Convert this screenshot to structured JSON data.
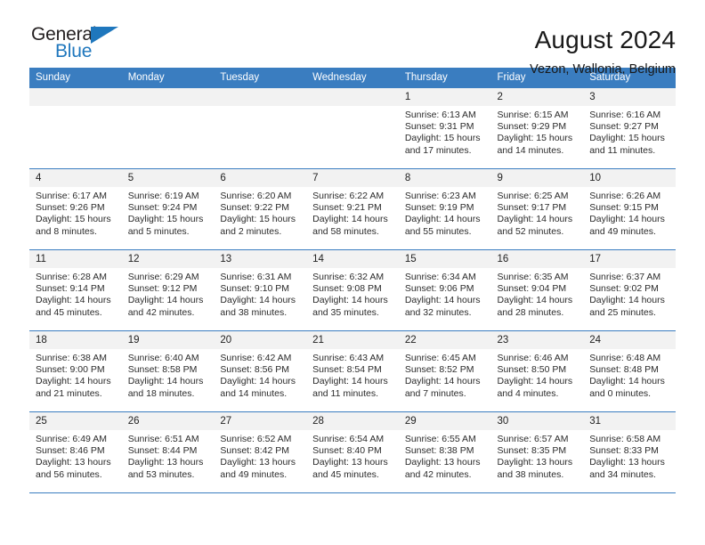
{
  "logo": {
    "line1": "General",
    "line2": "Blue",
    "triangle_icon": "triangle-icon",
    "brand_color": "#1f77bd"
  },
  "header": {
    "title": "August 2024",
    "subtitle": "Vezon, Wallonia, Belgium"
  },
  "calendar": {
    "header_bg": "#3a7dc0",
    "daynum_bg": "#f2f2f2",
    "weekdays": [
      "Sunday",
      "Monday",
      "Tuesday",
      "Wednesday",
      "Thursday",
      "Friday",
      "Saturday"
    ],
    "weeks": [
      [
        {
          "day": "",
          "lines": []
        },
        {
          "day": "",
          "lines": []
        },
        {
          "day": "",
          "lines": []
        },
        {
          "day": "",
          "lines": []
        },
        {
          "day": "1",
          "lines": [
            "Sunrise: 6:13 AM",
            "Sunset: 9:31 PM",
            "Daylight: 15 hours",
            "and 17 minutes."
          ]
        },
        {
          "day": "2",
          "lines": [
            "Sunrise: 6:15 AM",
            "Sunset: 9:29 PM",
            "Daylight: 15 hours",
            "and 14 minutes."
          ]
        },
        {
          "day": "3",
          "lines": [
            "Sunrise: 6:16 AM",
            "Sunset: 9:27 PM",
            "Daylight: 15 hours",
            "and 11 minutes."
          ]
        }
      ],
      [
        {
          "day": "4",
          "lines": [
            "Sunrise: 6:17 AM",
            "Sunset: 9:26 PM",
            "Daylight: 15 hours",
            "and 8 minutes."
          ]
        },
        {
          "day": "5",
          "lines": [
            "Sunrise: 6:19 AM",
            "Sunset: 9:24 PM",
            "Daylight: 15 hours",
            "and 5 minutes."
          ]
        },
        {
          "day": "6",
          "lines": [
            "Sunrise: 6:20 AM",
            "Sunset: 9:22 PM",
            "Daylight: 15 hours",
            "and 2 minutes."
          ]
        },
        {
          "day": "7",
          "lines": [
            "Sunrise: 6:22 AM",
            "Sunset: 9:21 PM",
            "Daylight: 14 hours",
            "and 58 minutes."
          ]
        },
        {
          "day": "8",
          "lines": [
            "Sunrise: 6:23 AM",
            "Sunset: 9:19 PM",
            "Daylight: 14 hours",
            "and 55 minutes."
          ]
        },
        {
          "day": "9",
          "lines": [
            "Sunrise: 6:25 AM",
            "Sunset: 9:17 PM",
            "Daylight: 14 hours",
            "and 52 minutes."
          ]
        },
        {
          "day": "10",
          "lines": [
            "Sunrise: 6:26 AM",
            "Sunset: 9:15 PM",
            "Daylight: 14 hours",
            "and 49 minutes."
          ]
        }
      ],
      [
        {
          "day": "11",
          "lines": [
            "Sunrise: 6:28 AM",
            "Sunset: 9:14 PM",
            "Daylight: 14 hours",
            "and 45 minutes."
          ]
        },
        {
          "day": "12",
          "lines": [
            "Sunrise: 6:29 AM",
            "Sunset: 9:12 PM",
            "Daylight: 14 hours",
            "and 42 minutes."
          ]
        },
        {
          "day": "13",
          "lines": [
            "Sunrise: 6:31 AM",
            "Sunset: 9:10 PM",
            "Daylight: 14 hours",
            "and 38 minutes."
          ]
        },
        {
          "day": "14",
          "lines": [
            "Sunrise: 6:32 AM",
            "Sunset: 9:08 PM",
            "Daylight: 14 hours",
            "and 35 minutes."
          ]
        },
        {
          "day": "15",
          "lines": [
            "Sunrise: 6:34 AM",
            "Sunset: 9:06 PM",
            "Daylight: 14 hours",
            "and 32 minutes."
          ]
        },
        {
          "day": "16",
          "lines": [
            "Sunrise: 6:35 AM",
            "Sunset: 9:04 PM",
            "Daylight: 14 hours",
            "and 28 minutes."
          ]
        },
        {
          "day": "17",
          "lines": [
            "Sunrise: 6:37 AM",
            "Sunset: 9:02 PM",
            "Daylight: 14 hours",
            "and 25 minutes."
          ]
        }
      ],
      [
        {
          "day": "18",
          "lines": [
            "Sunrise: 6:38 AM",
            "Sunset: 9:00 PM",
            "Daylight: 14 hours",
            "and 21 minutes."
          ]
        },
        {
          "day": "19",
          "lines": [
            "Sunrise: 6:40 AM",
            "Sunset: 8:58 PM",
            "Daylight: 14 hours",
            "and 18 minutes."
          ]
        },
        {
          "day": "20",
          "lines": [
            "Sunrise: 6:42 AM",
            "Sunset: 8:56 PM",
            "Daylight: 14 hours",
            "and 14 minutes."
          ]
        },
        {
          "day": "21",
          "lines": [
            "Sunrise: 6:43 AM",
            "Sunset: 8:54 PM",
            "Daylight: 14 hours",
            "and 11 minutes."
          ]
        },
        {
          "day": "22",
          "lines": [
            "Sunrise: 6:45 AM",
            "Sunset: 8:52 PM",
            "Daylight: 14 hours",
            "and 7 minutes."
          ]
        },
        {
          "day": "23",
          "lines": [
            "Sunrise: 6:46 AM",
            "Sunset: 8:50 PM",
            "Daylight: 14 hours",
            "and 4 minutes."
          ]
        },
        {
          "day": "24",
          "lines": [
            "Sunrise: 6:48 AM",
            "Sunset: 8:48 PM",
            "Daylight: 14 hours",
            "and 0 minutes."
          ]
        }
      ],
      [
        {
          "day": "25",
          "lines": [
            "Sunrise: 6:49 AM",
            "Sunset: 8:46 PM",
            "Daylight: 13 hours",
            "and 56 minutes."
          ]
        },
        {
          "day": "26",
          "lines": [
            "Sunrise: 6:51 AM",
            "Sunset: 8:44 PM",
            "Daylight: 13 hours",
            "and 53 minutes."
          ]
        },
        {
          "day": "27",
          "lines": [
            "Sunrise: 6:52 AM",
            "Sunset: 8:42 PM",
            "Daylight: 13 hours",
            "and 49 minutes."
          ]
        },
        {
          "day": "28",
          "lines": [
            "Sunrise: 6:54 AM",
            "Sunset: 8:40 PM",
            "Daylight: 13 hours",
            "and 45 minutes."
          ]
        },
        {
          "day": "29",
          "lines": [
            "Sunrise: 6:55 AM",
            "Sunset: 8:38 PM",
            "Daylight: 13 hours",
            "and 42 minutes."
          ]
        },
        {
          "day": "30",
          "lines": [
            "Sunrise: 6:57 AM",
            "Sunset: 8:35 PM",
            "Daylight: 13 hours",
            "and 38 minutes."
          ]
        },
        {
          "day": "31",
          "lines": [
            "Sunrise: 6:58 AM",
            "Sunset: 8:33 PM",
            "Daylight: 13 hours",
            "and 34 minutes."
          ]
        }
      ]
    ]
  }
}
